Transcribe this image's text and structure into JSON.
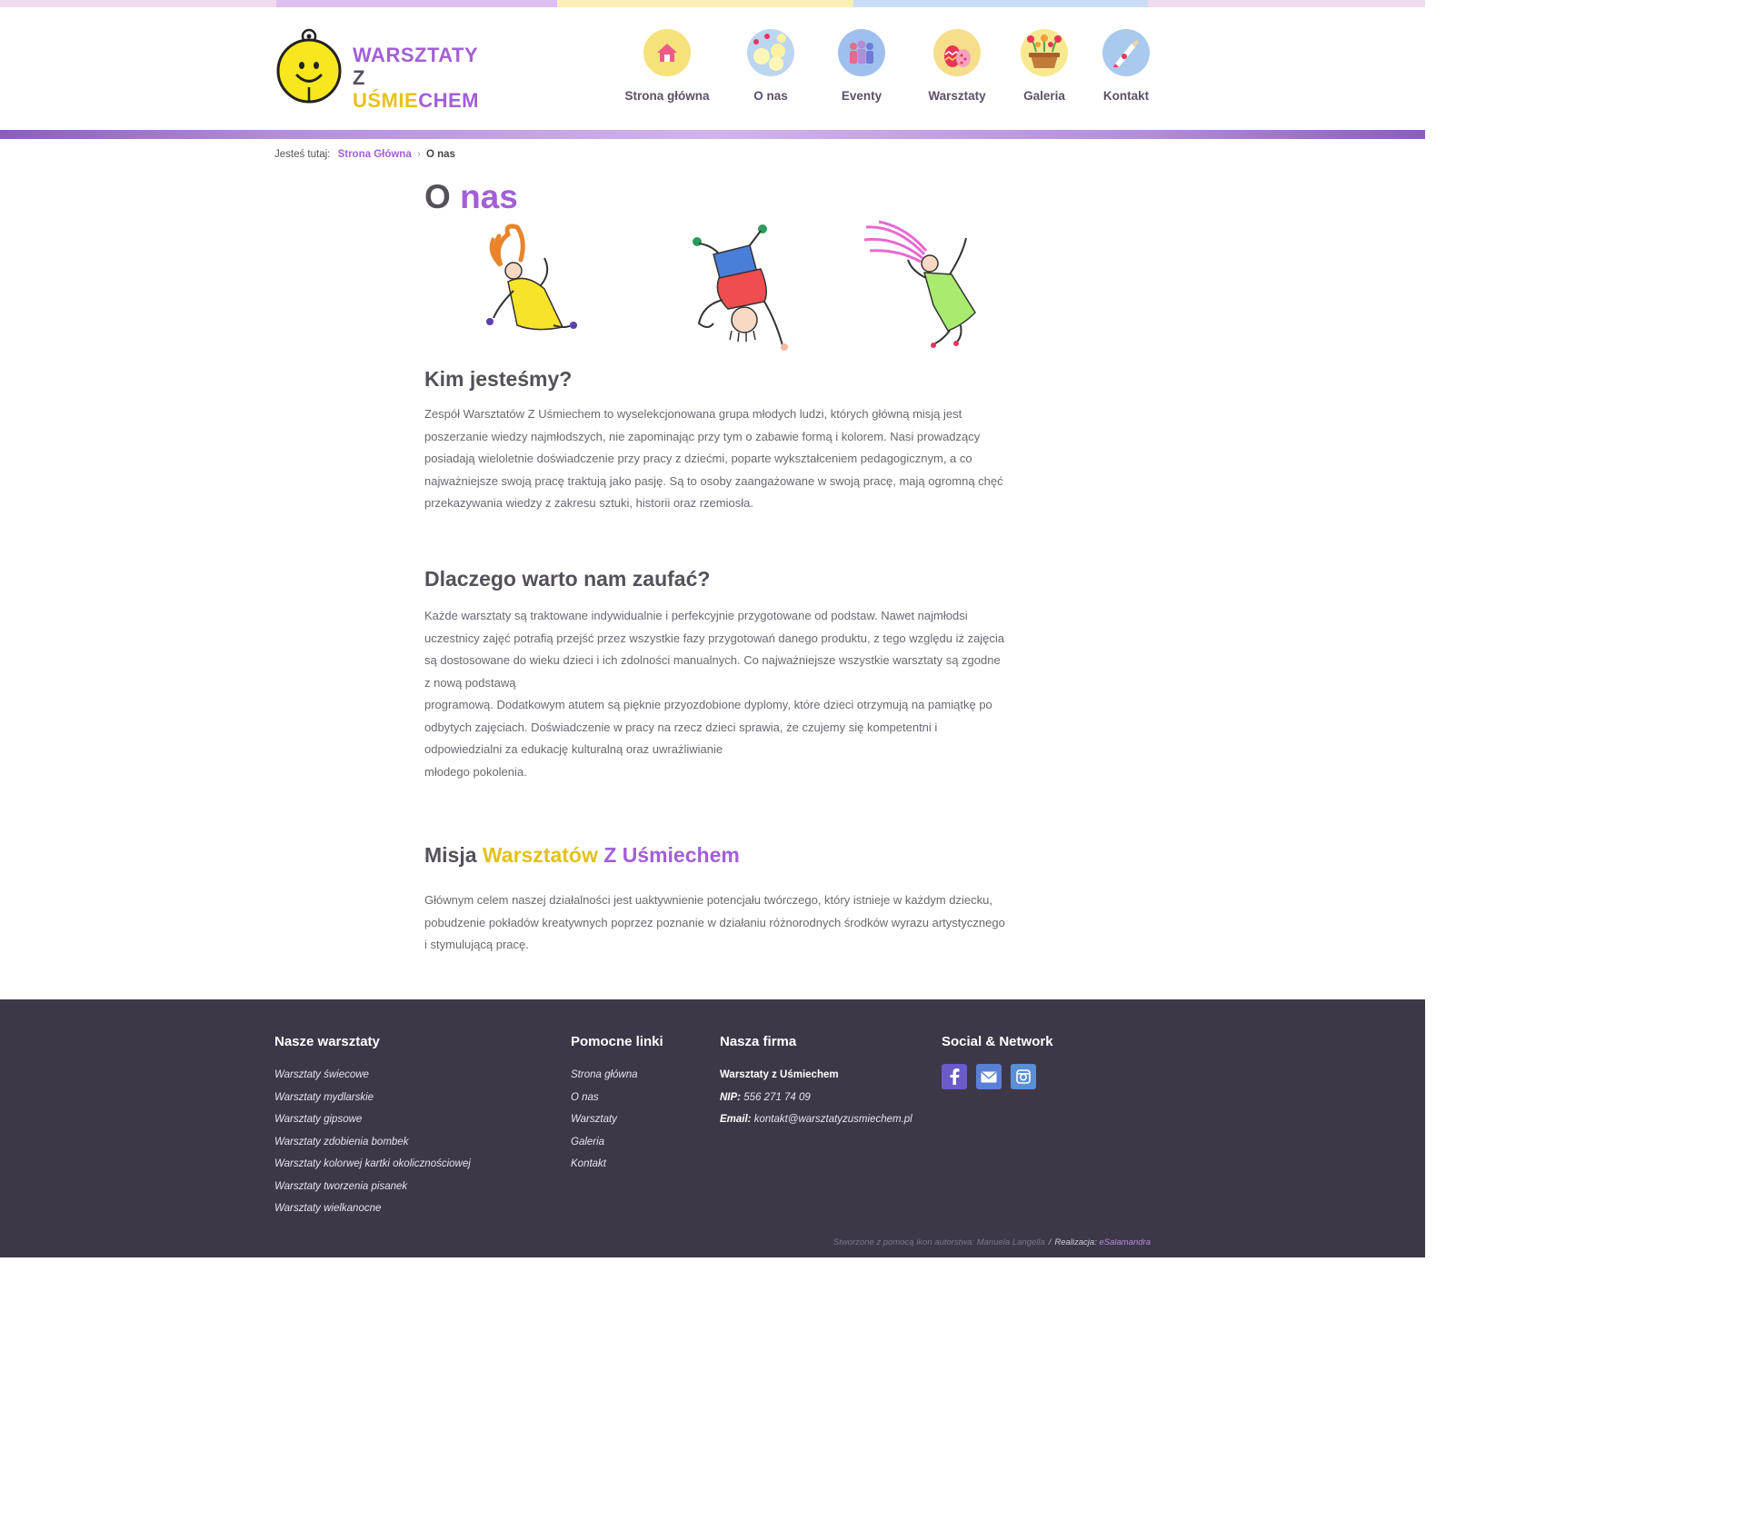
{
  "brand": {
    "line1": "WARSZTATY",
    "z": "Z ",
    "u": "UŚMIE",
    "s": "CHEM",
    "logo_alt": "Warsztaty z Uśmiechem"
  },
  "nav": [
    {
      "label": "Strona główna",
      "icon": "home-icon",
      "color": "#f5e27a"
    },
    {
      "label": "O nas",
      "icon": "chicks-icon",
      "color": "#bcd5f1"
    },
    {
      "label": "Eventy",
      "icon": "people-icon",
      "color": "#9fc0ee"
    },
    {
      "label": "Warsztaty",
      "icon": "easter-eggs-icon",
      "color": "#f6de8a"
    },
    {
      "label": "Galeria",
      "icon": "flower-pot-icon",
      "color": "#f8e88f"
    },
    {
      "label": "Kontakt",
      "icon": "letter-icon",
      "color": "#a9c9ef"
    }
  ],
  "breadcrumb": {
    "prefix": "Jesteś tutaj:",
    "home": "Strona Główna",
    "separator": "›",
    "current": "O nas"
  },
  "page": {
    "title_plain": "O ",
    "title_accent": "nas"
  },
  "sections": [
    {
      "heading": "Kim jesteśmy?",
      "text": "Zespół Warsztatów Z Uśmiechem to wyselekcjonowana grupa młodych ludzi, których główną misją jest poszerzanie wiedzy najmłodszych, nie zapominając przy tym o zabawie formą i kolorem. Nasi prowadzący posiadają wieloletnie doświadczenie przy pracy z dziećmi, poparte wykształceniem pedagogicznym, a co najważniejsze swoją pracę traktują jako pasję. Są to osoby zaangażowane w swoją pracę, mają ogromną chęć przekazywania wiedzy z zakresu sztuki, historii oraz rzemiosła."
    },
    {
      "heading": "Dlaczego warto nam zaufać?",
      "text1": "Każde warsztaty są traktowane indywidualnie i perfekcyjnie przygotowane od podstaw. Nawet najmłodsi uczestnicy zajęć potrafią przejść przez wszystkie fazy przygotowań danego produktu, z tego względu iż zajęcia są dostosowane do wieku dzieci i ich zdolności manualnych. Co najważniejsze wszystkie warsztaty są zgodne z nową podstawą",
      "text2": "programową. Dodatkowym atutem są pięknie przyozdobione dyplomy, które dzieci otrzymują na pamiątkę po odbytych zajęciach. Doświadczenie w pracy na rzecz dzieci sprawia, że czujemy się kompetentni i odpowiedzialni za edukację kulturalną oraz uwrażliwianie",
      "text3": "młodego pokolenia."
    },
    {
      "heading_plain": "Misja ",
      "heading_yellow": "Warsztatów ",
      "heading_purple": "Z Uśmiechem",
      "text": "Głównym celem naszej działalności jest uaktywnienie potencjału twórczego, który istnieje w każdym dziecku, pobudzenie pokładów kreatywnych poprzez poznanie w działaniu różnorodnych środków wyrazu artystycznego i stymulującą pracę."
    }
  ],
  "footer": {
    "workshops": {
      "heading": "Nasze warsztaty",
      "items": [
        "Warsztaty świecowe",
        "Warsztaty mydlarskie",
        "Warsztaty gipsowe",
        "Warsztaty zdobienia bombek",
        "Warsztaty kolorwej kartki okolicznościowej",
        "Warsztaty tworzenia pisanek",
        "Warsztaty wielkanocne"
      ]
    },
    "links": {
      "heading": "Pomocne linki",
      "items": [
        "Strona główna",
        "O nas",
        "Warsztaty",
        "Galeria",
        "Kontakt"
      ]
    },
    "company": {
      "heading": "Nasza firma",
      "name": "Warsztaty z Uśmiechem",
      "nip_label": "NIP:",
      "nip": "556 271 74 09",
      "email_label": "Email:",
      "email": "kontakt@warsztatyzusmiechem.pl"
    },
    "social": {
      "heading": "Social & Network",
      "items": [
        {
          "name": "facebook-icon",
          "glyph": "f"
        },
        {
          "name": "mail-icon",
          "glyph": "✉"
        },
        {
          "name": "instagram-icon",
          "glyph": "◘"
        }
      ]
    },
    "credits": {
      "icons_note": "Stworzone z pomocą ikon autorstwa: Manuela Langella",
      "separator": "/",
      "realization_label": "Realizacja:",
      "realization": "eSalamandra"
    }
  },
  "colors": {
    "accent_purple": "#a25fd8",
    "accent_yellow": "#e2c21a",
    "footer_bg": "#3e3748",
    "text_dark": "#555059"
  }
}
